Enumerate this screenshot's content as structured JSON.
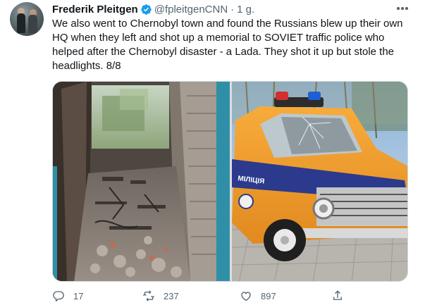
{
  "author": {
    "name": "Frederik Pleitgen",
    "handle": "@fpleitgenCNN",
    "separator": "·",
    "time": "1 g."
  },
  "tweet": {
    "lines": [
      "We also went to Chernobyl town and found the Russians blew up their own",
      "HQ when they left and shot up a memorial to SOVIET traffic police who",
      "helped after the Chernobyl disaster - a Lada. They shot it up but stole the",
      "headlights. 8/8"
    ]
  },
  "media": {
    "car_door_text": "МІЛІЦІЯ"
  },
  "actions": {
    "replies": "17",
    "retweets": "237",
    "likes": "897"
  },
  "icons": {
    "verified": "verified-badge-icon",
    "more": "more-horizontal-icon",
    "reply": "reply-icon",
    "retweet": "retweet-icon",
    "like": "heart-icon",
    "share": "share-icon"
  },
  "colors": {
    "verified_blue": "#1d9bf0",
    "text_secondary": "#536471",
    "text_primary": "#0f1419",
    "car_orange": "#f39a2a",
    "car_stripe": "#2b3a8c"
  }
}
